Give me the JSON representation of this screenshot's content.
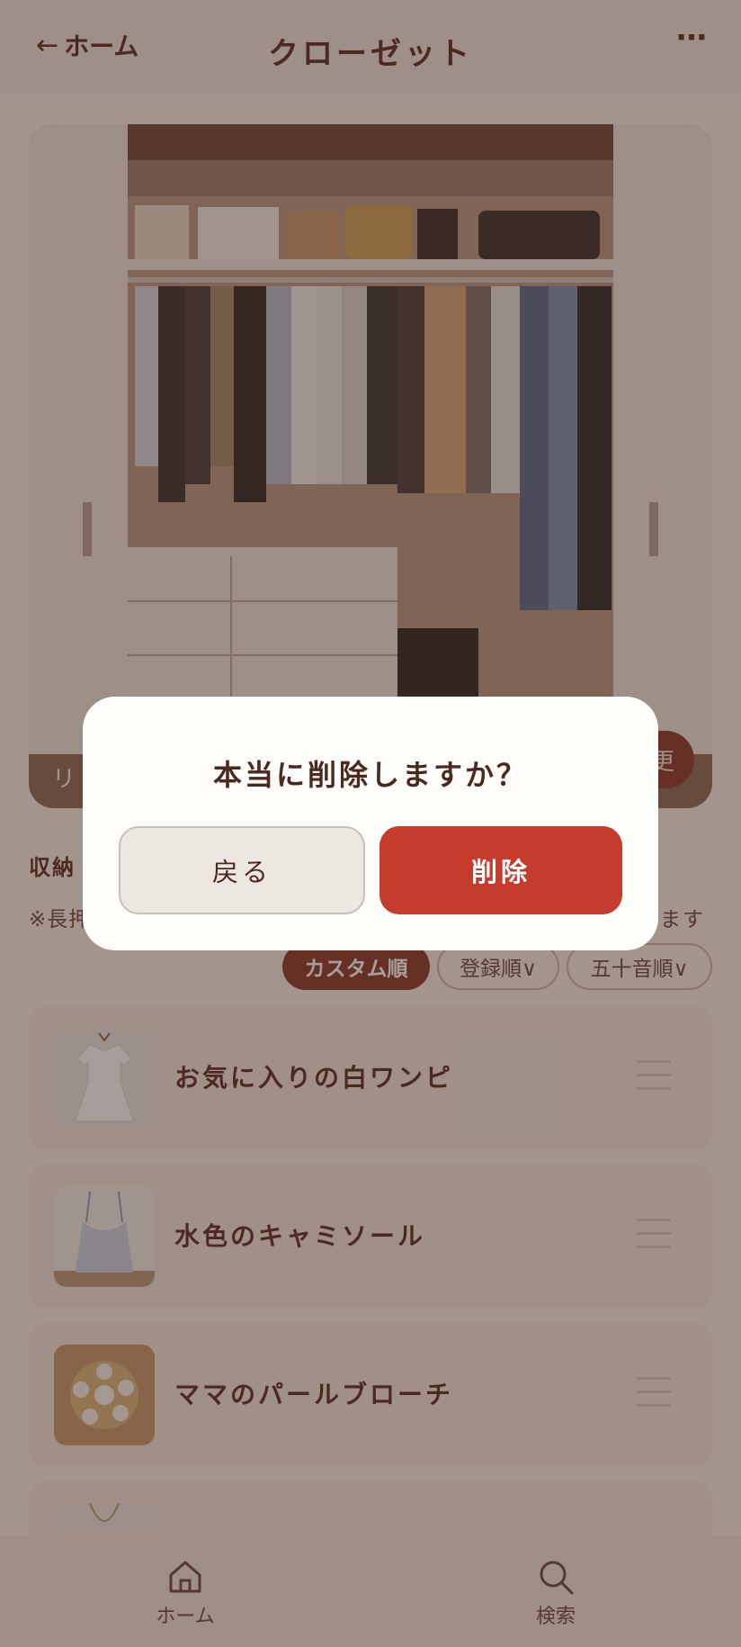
{
  "header": {
    "back_arrow": "←",
    "back_label": "ホーム",
    "title": "クローゼット",
    "more": "⋯"
  },
  "photo": {
    "label": "リビ",
    "change_button": "更"
  },
  "section": {
    "heading": "収納",
    "note_left": "※長押",
    "note_right": "ます"
  },
  "sort": {
    "custom": "カスタム順",
    "registered": "登録順∨",
    "alphabetical": "五十音順∨"
  },
  "items": [
    {
      "title": "お気に入りの白ワンピ"
    },
    {
      "title": "水色のキャミソール"
    },
    {
      "title": "ママのパールブローチ"
    }
  ],
  "tabbar": {
    "home": "ホーム",
    "search": "検索"
  },
  "dialog": {
    "title": "本当に削除しますか？",
    "back_button": "戻る",
    "delete_button": "削除"
  }
}
